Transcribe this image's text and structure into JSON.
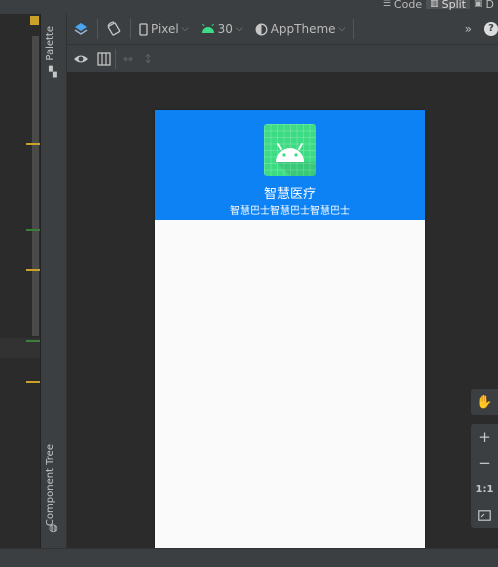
{
  "view_tabs": {
    "code": "Code",
    "split": "Split",
    "design": "D"
  },
  "rail": {
    "palette": "Palette",
    "component_tree": "Component Tree"
  },
  "toolbar": {
    "device": "Pixel",
    "api_level": "30",
    "theme": "AppTheme",
    "overflow": "»",
    "android_color": "#3ddc84"
  },
  "app": {
    "header_color": "#0d82f5",
    "title": "智慧医疗",
    "subtitle": "智慧巴士智慧巴士智慧巴士"
  },
  "zoom": {
    "zoom_in": "+",
    "zoom_out": "−",
    "actual_size": "1:1"
  },
  "gutter_marks": {
    "warning": "#c9a227",
    "ok": "#3a7f3a"
  }
}
